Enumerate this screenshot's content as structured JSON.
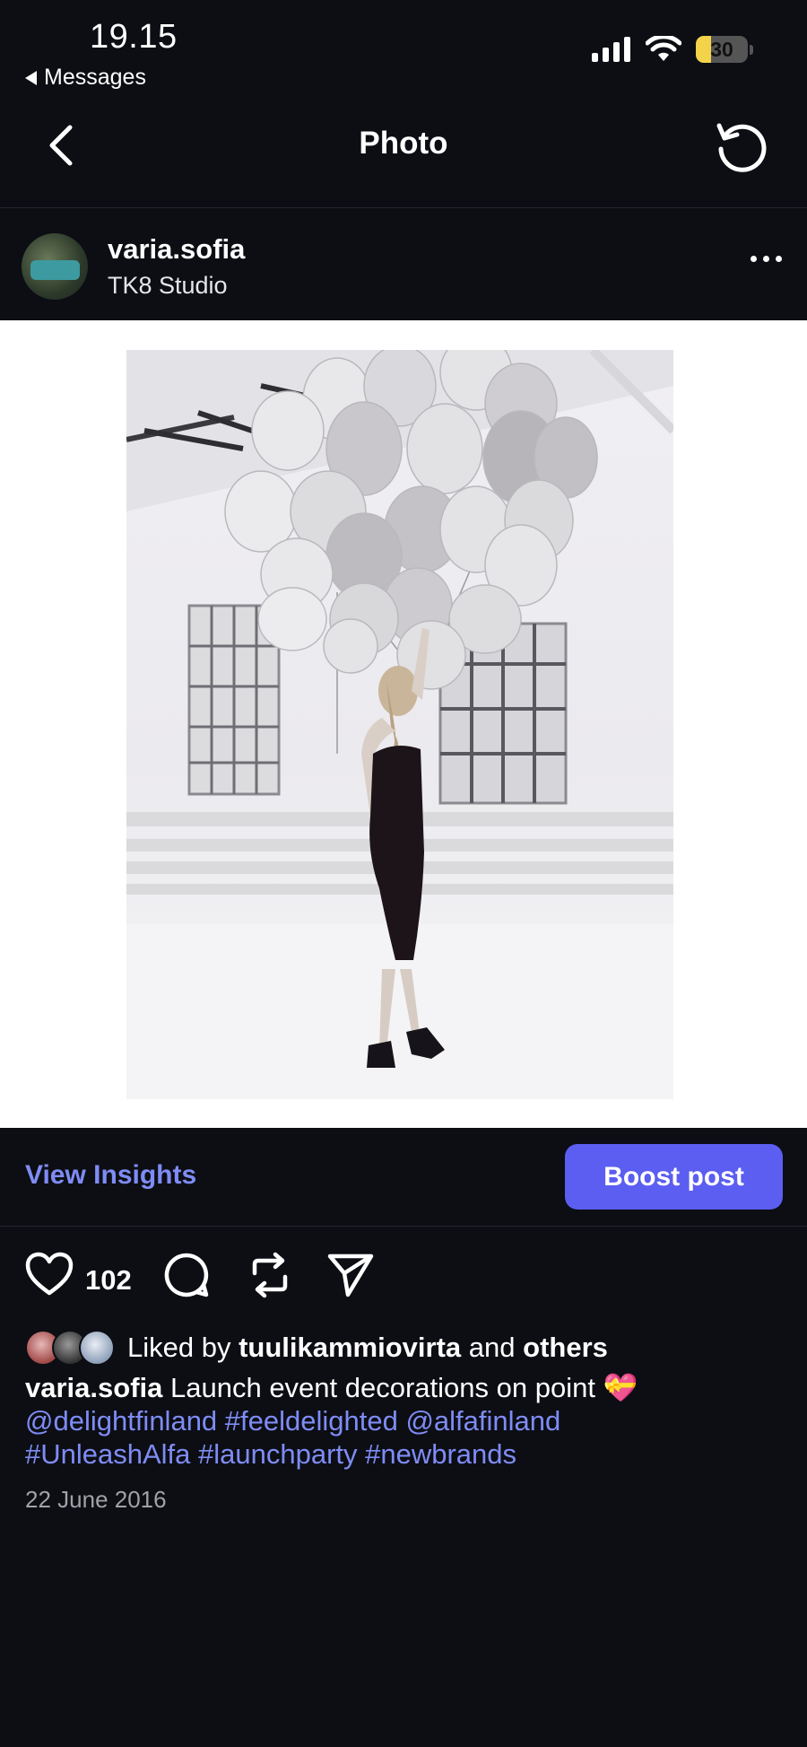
{
  "status": {
    "time": "19.15",
    "back_app": "Messages",
    "battery": "30",
    "battery_level": 0.3
  },
  "nav": {
    "title": "Photo"
  },
  "post": {
    "username": "varia.sofia",
    "location": "TK8 Studio"
  },
  "insights": {
    "view_label": "View Insights",
    "boost_label": "Boost post"
  },
  "actions": {
    "like_count": "102"
  },
  "likes": {
    "prefix": "Liked by",
    "user": "tuulikammiovirta",
    "and": "and",
    "others": "others"
  },
  "caption": {
    "username": "varia.sofia",
    "text": "Launch event decorations on point 💝",
    "tags_line1": "@delightfinland #feeldelighted  @alfafinland",
    "tags_line2": "#UnleashAlfa #launchparty #newbrands"
  },
  "date": "22 June 2016",
  "colors": {
    "background": "#0c0e14",
    "accent_link": "#7f8cf5",
    "boost_button": "#5b5ef0",
    "battery_fill": "#f3d34a"
  }
}
